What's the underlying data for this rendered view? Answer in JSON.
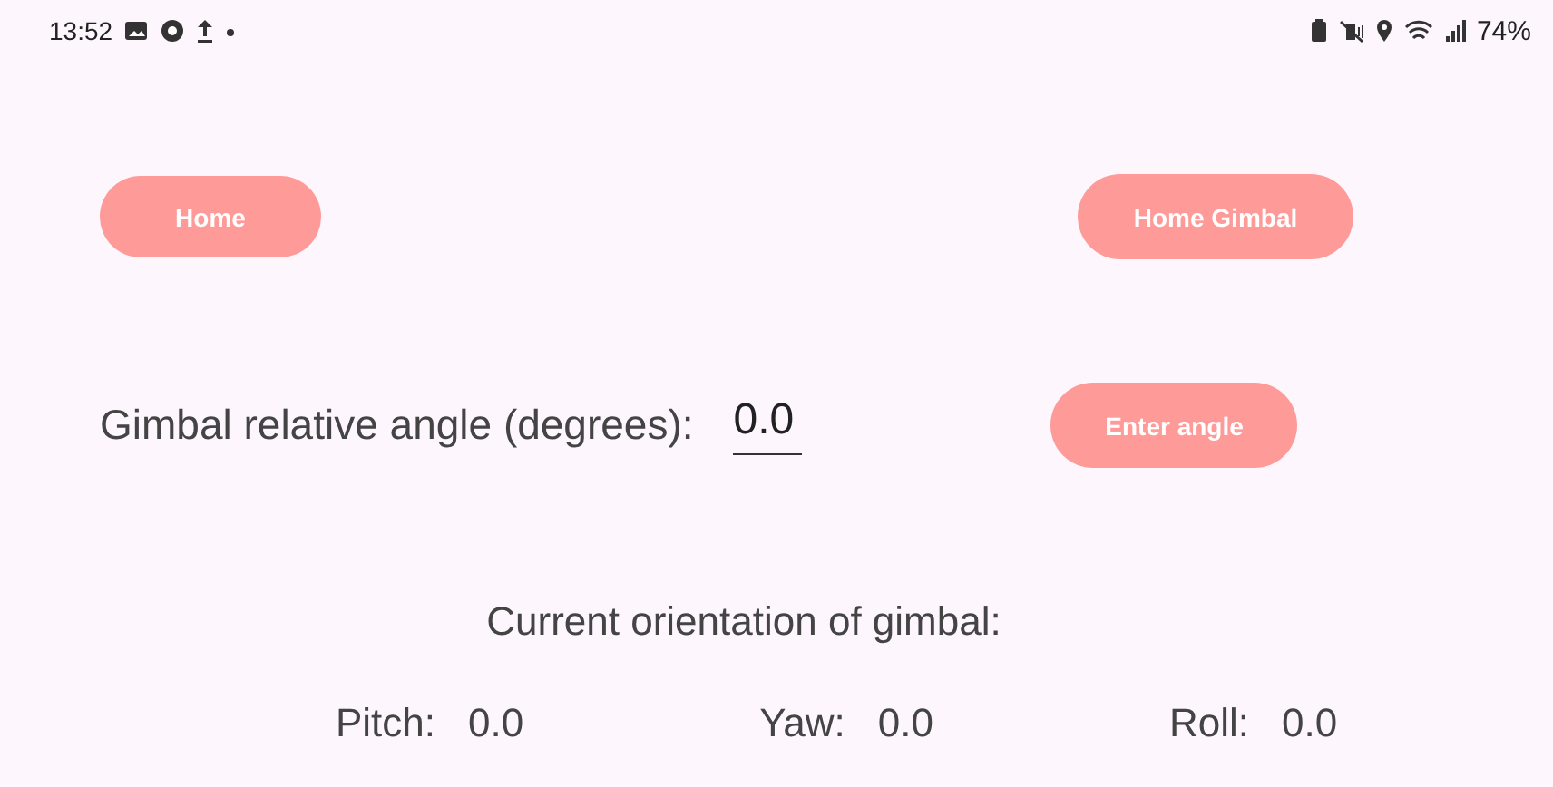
{
  "status_bar": {
    "time": "13:52",
    "battery_percent": "74%"
  },
  "buttons_top": [
    {
      "label": "Home"
    },
    {
      "label": "Home Gimbal"
    }
  ],
  "angle_input": {
    "label": "Gimbal relative angle (degrees):",
    "value": "0.0",
    "button": "Enter angle"
  },
  "orientation": {
    "title": "Current orientation of gimbal:",
    "readings": [
      {
        "label": "Pitch:",
        "value": "0.0"
      },
      {
        "label": "Yaw:",
        "value": "0.0"
      },
      {
        "label": "Roll:",
        "value": "0.0"
      }
    ]
  }
}
